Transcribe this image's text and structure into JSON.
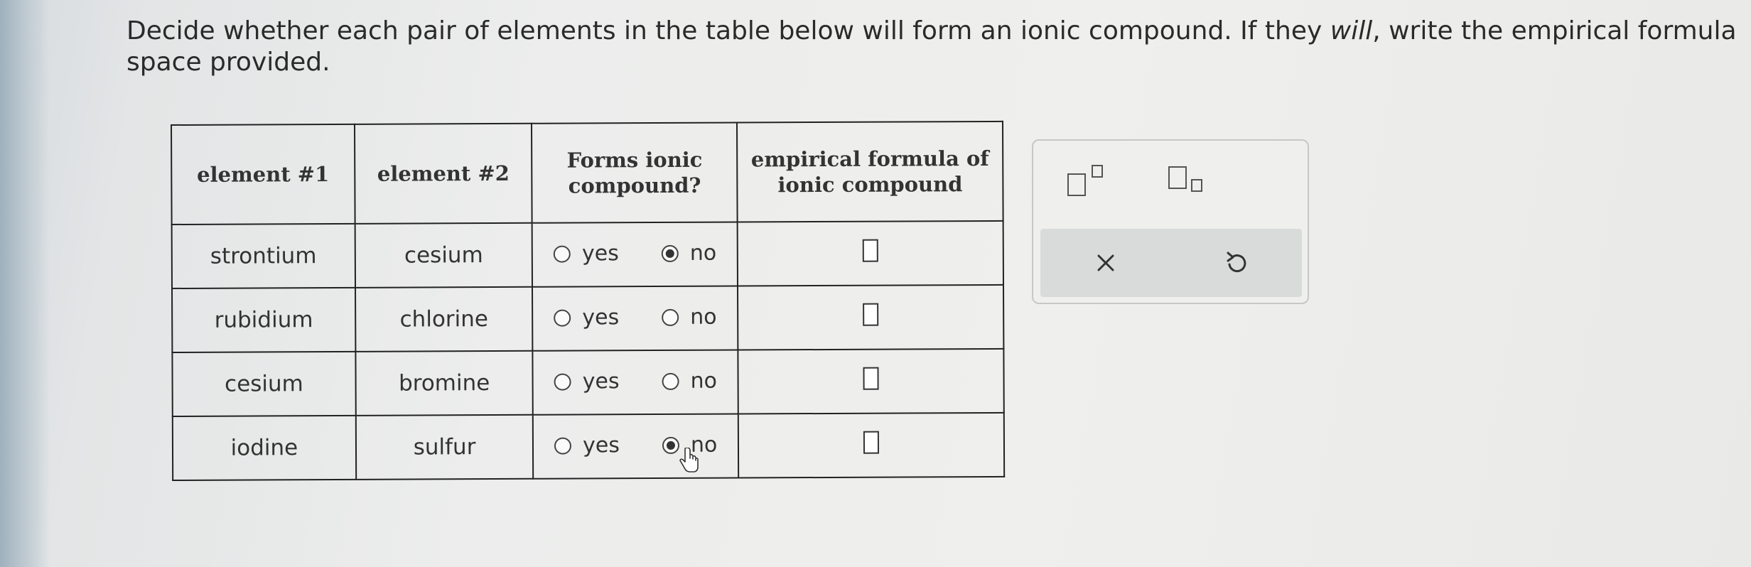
{
  "instructions": {
    "line1_part1": "Decide whether each pair of elements in the table below will form an ionic compound. If they ",
    "line1_em": "will",
    "line1_part2": ", write the empirical formula of the compou",
    "line2": "space provided."
  },
  "table": {
    "headers": [
      "element #1",
      "element #2",
      "Forms ionic compound?",
      "empirical formula of ionic compound"
    ],
    "rows": [
      {
        "element1": "strontium",
        "element2": "cesium",
        "yes_label": "yes",
        "no_label": "no",
        "selected": "no",
        "formula": ""
      },
      {
        "element1": "rubidium",
        "element2": "chlorine",
        "yes_label": "yes",
        "no_label": "no",
        "selected": "",
        "formula": ""
      },
      {
        "element1": "cesium",
        "element2": "bromine",
        "yes_label": "yes",
        "no_label": "no",
        "selected": "",
        "formula": ""
      },
      {
        "element1": "iodine",
        "element2": "sulfur",
        "yes_label": "yes",
        "no_label": "no",
        "selected": "no",
        "formula": ""
      }
    ]
  },
  "tools": {
    "superscript_icon": "superscript-icon",
    "subscript_icon": "subscript-icon",
    "clear_icon": "close-icon",
    "undo_icon": "undo-icon"
  }
}
